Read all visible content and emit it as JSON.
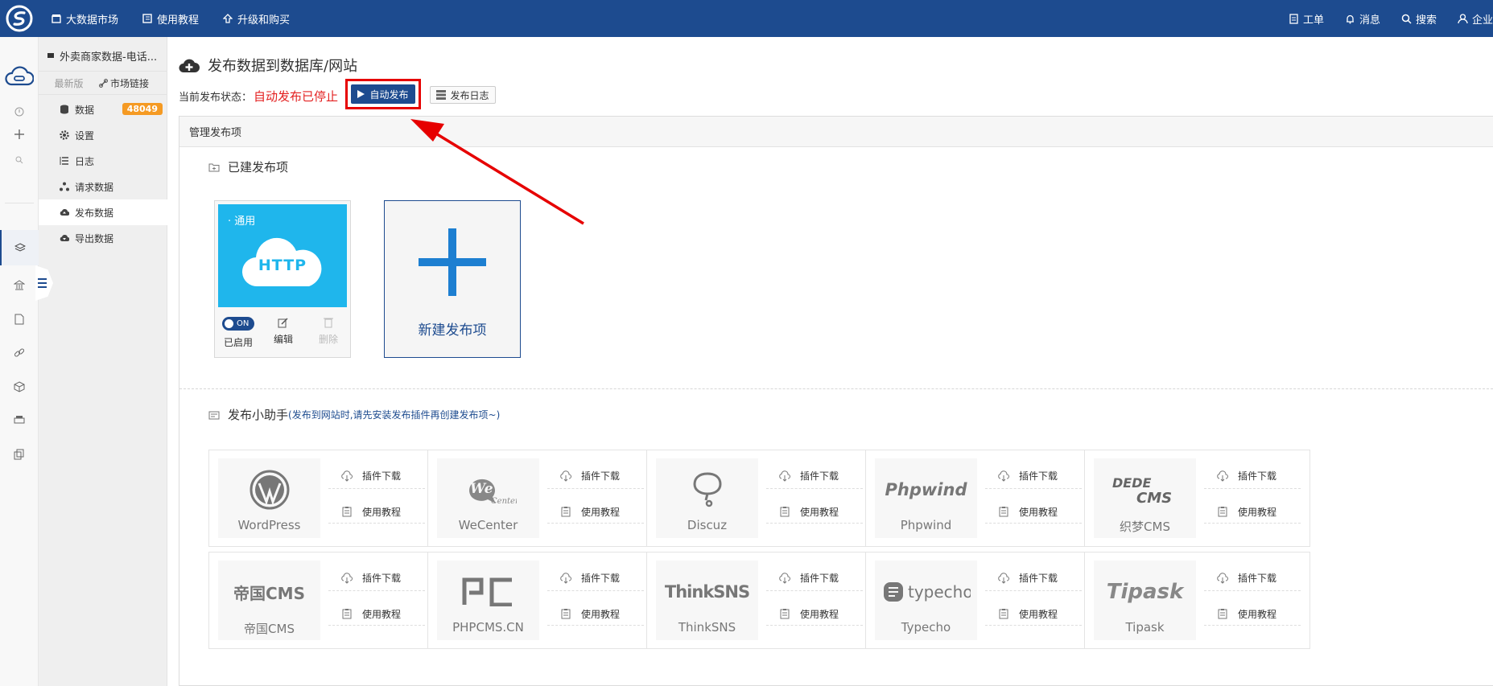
{
  "topbar": {
    "nav": [
      {
        "label": "大数据市场",
        "icon": "store-icon"
      },
      {
        "label": "使用教程",
        "icon": "book-icon"
      },
      {
        "label": "升级和购买",
        "icon": "upgrade-icon"
      }
    ],
    "right": [
      {
        "label": "工单",
        "icon": "ticket-icon"
      },
      {
        "label": "消息",
        "icon": "bell-icon"
      },
      {
        "label": "搜索",
        "icon": "search-icon"
      },
      {
        "label": "企业",
        "icon": "user-icon"
      }
    ]
  },
  "sidebar": {
    "title": "外卖商家数据-电话...",
    "version": "最新版",
    "market_link": "市场链接",
    "items": [
      {
        "label": "数据",
        "badge": "48049"
      },
      {
        "label": "设置"
      },
      {
        "label": "日志"
      },
      {
        "label": "请求数据"
      },
      {
        "label": "发布数据"
      },
      {
        "label": "导出数据"
      }
    ]
  },
  "main": {
    "page_title": "发布数据到数据库/网站",
    "status_label": "当前发布状态：",
    "status_value": "自动发布已停止",
    "auto_publish_label": "自动发布",
    "publish_log_label": "发布日志",
    "panel_title": "管理发布项",
    "created_title": "已建发布项",
    "http_card": {
      "tag": "· 通用",
      "logo_text": "HTTP",
      "toggle": "ON",
      "enabled_label": "已启用",
      "edit_label": "编辑",
      "delete_label": "删除"
    },
    "new_card_label": "新建发布项",
    "assistant_title": "发布小助手",
    "assistant_hint": "(发布到网站时,请先安装发布插件再创建发布项~)",
    "download_label": "插件下载",
    "tutorial_label": "使用教程",
    "plugins": [
      {
        "name": "WordPress",
        "art": "wordpress"
      },
      {
        "name": "WeCenter",
        "art": "wecenter"
      },
      {
        "name": "Discuz",
        "art": "discuz"
      },
      {
        "name": "Phpwind",
        "art": "phpwind"
      },
      {
        "name": "织梦CMS",
        "art": "dedecms"
      },
      {
        "name": "帝国CMS",
        "art": "diguo"
      },
      {
        "name": "PHPCMS.CN",
        "art": "phpcms"
      },
      {
        "name": "ThinkSNS",
        "art": "thinksns"
      },
      {
        "name": "Typecho",
        "art": "typecho"
      },
      {
        "name": "Tipask",
        "art": "tipask"
      }
    ],
    "colors": {
      "brand": "#1d4b8f",
      "badge": "#f59a23",
      "alert": "#e60000",
      "http_bg": "#1fb6ec"
    }
  }
}
